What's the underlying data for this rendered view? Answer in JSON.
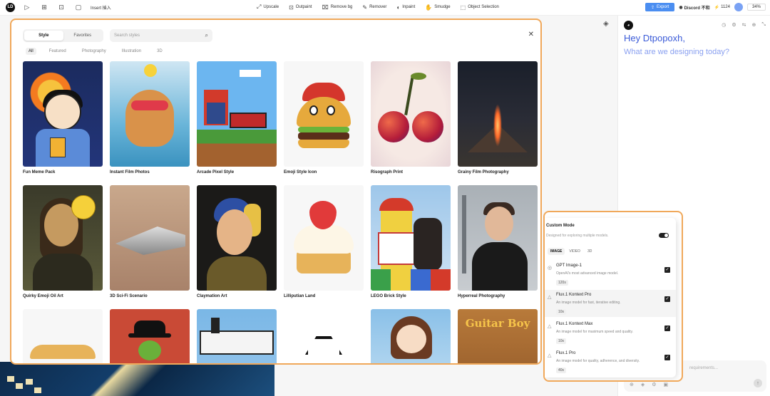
{
  "topbar": {
    "logo": "LD",
    "insert_label": "Insert 插入",
    "tools": [
      {
        "icon": "upscale-icon",
        "label": "Upscale"
      },
      {
        "icon": "outpaint-icon",
        "label": "Outpaint"
      },
      {
        "icon": "remove-bg-icon",
        "label": "Remove bg"
      },
      {
        "icon": "remover-icon",
        "label": "Remover"
      },
      {
        "icon": "inpaint-icon",
        "label": "Inpaint"
      },
      {
        "icon": "smudge-icon",
        "label": "Smudge"
      },
      {
        "icon": "object-selection-icon",
        "label": "Object Selection"
      }
    ],
    "export_label": "Export",
    "discord_label": "Discord 不和",
    "credits": "1124",
    "zoom": "34%"
  },
  "styles_panel": {
    "tabs": [
      "Style",
      "Favorites"
    ],
    "active_tab": "Style",
    "search_placeholder": "Search styles",
    "filters": [
      "All",
      "Featured",
      "Photography",
      "Illustration",
      "3D"
    ],
    "active_filter": "All",
    "cards": [
      {
        "label": "Fun Meme Pack",
        "art": "i1"
      },
      {
        "label": "Instant Film Photos",
        "art": "i2"
      },
      {
        "label": "Arcade Pixel Style",
        "art": "i3"
      },
      {
        "label": "Emoji Style Icon",
        "art": "i4"
      },
      {
        "label": "Risograph Print",
        "art": "i5"
      },
      {
        "label": "Grainy Film Photography",
        "art": "i6"
      },
      {
        "label": "Quirky Emoji Oil Art",
        "art": "i7"
      },
      {
        "label": "3D Sci-Fi Scenario",
        "art": "i8"
      },
      {
        "label": "Claymation Art",
        "art": "i9"
      },
      {
        "label": "Lilliputian Land",
        "art": "i10"
      },
      {
        "label": "LEGO Brick Style",
        "art": "i11"
      },
      {
        "label": "Hyperreal Photography",
        "art": "i12"
      },
      {
        "label": "",
        "art": "i13"
      },
      {
        "label": "",
        "art": "i14"
      },
      {
        "label": "",
        "art": "i15"
      },
      {
        "label": "",
        "art": "i16"
      },
      {
        "label": "",
        "art": "i17"
      },
      {
        "label": "",
        "art": "i18"
      }
    ],
    "guitar_sign": "Guitar Boy"
  },
  "chat": {
    "greeting": "Hey Dtpopoxh,",
    "subtitle": "What are we designing today?",
    "input_placeholder": "requirements..."
  },
  "custom_mode": {
    "title": "Custom Mode",
    "description": "Designed for exploring multiple models.",
    "toggle_on": true,
    "tabs": [
      "IMAGE",
      "VIDEO",
      "3D"
    ],
    "active_tab": "IMAGE",
    "models": [
      {
        "name": "GPT Image-1",
        "desc": "OpenAI's most advanced image model.",
        "time": "120s",
        "checked": true,
        "selected": false
      },
      {
        "name": "Flux.1 Kontext Pro",
        "desc": "An image model for fast, iterative editing.",
        "time": "10s",
        "checked": true,
        "selected": true
      },
      {
        "name": "Flux.1 Kontext Max",
        "desc": "An image model for maximum speed and quality.",
        "time": "10s",
        "checked": true,
        "selected": false
      },
      {
        "name": "Flux.1 Pro",
        "desc": "An image model for quality, adherence, and diversity.",
        "time": "40s",
        "checked": true,
        "selected": false
      }
    ]
  },
  "colors": {
    "accent_blue": "#4b8ef1",
    "highlight_orange": "#f0a85a",
    "greeting_blue": "#3b5bd8"
  }
}
